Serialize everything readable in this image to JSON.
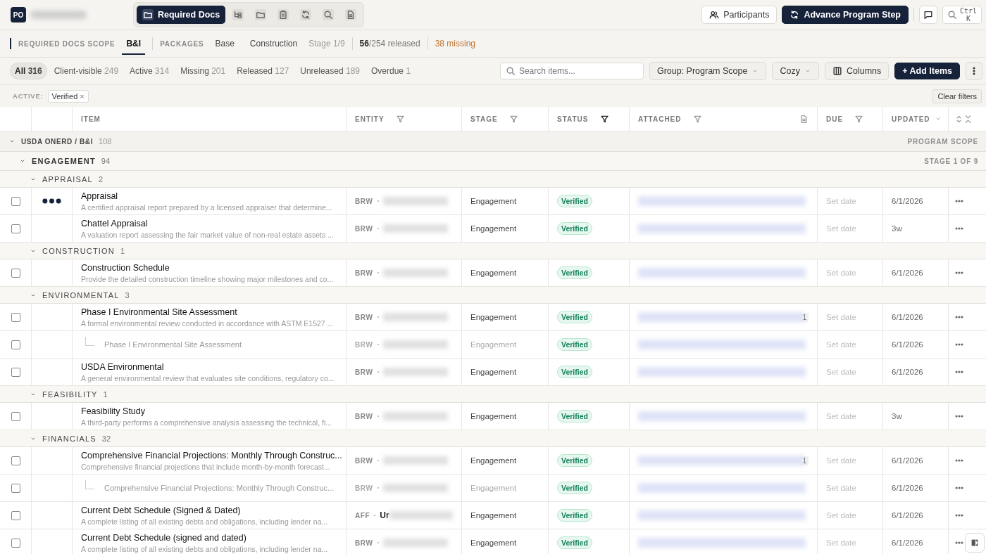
{
  "topbar": {
    "avatar": "PO",
    "nav": [
      {
        "kind": "label",
        "label": "Required Docs",
        "selected": true
      },
      {
        "kind": "icon",
        "selected": false
      },
      {
        "kind": "icon",
        "selected": false
      },
      {
        "kind": "icon",
        "selected": false
      },
      {
        "kind": "icon",
        "selected": false
      },
      {
        "kind": "icon",
        "selected": false
      },
      {
        "kind": "icon",
        "selected": false
      }
    ],
    "participants": "Participants",
    "advance": "Advance Program Step",
    "search_hint": "Ctrl K"
  },
  "scope": {
    "label": "REQUIRED DOCS SCOPE",
    "scope_tabs": [
      {
        "label": "B&I",
        "selected": true
      }
    ],
    "packages_label": "PACKAGES",
    "package_tabs": [
      {
        "label": "Base",
        "selected": false
      },
      {
        "label": "Construction",
        "selected": false
      }
    ],
    "stage": "Stage 1/9",
    "released": "**56**/254 released",
    "missing": "38 missing"
  },
  "filters": [
    {
      "label": "All",
      "count": "316",
      "selected": true
    },
    {
      "label": "Client-visible",
      "count": "249",
      "selected": false
    },
    {
      "label": "Active",
      "count": "314",
      "selected": false
    },
    {
      "label": "Missing",
      "count": "201",
      "selected": false
    },
    {
      "label": "Released",
      "count": "127",
      "selected": false
    },
    {
      "label": "Unreleased",
      "count": "189",
      "selected": false
    },
    {
      "label": "Overdue",
      "count": "1",
      "selected": false
    }
  ],
  "toolbar": {
    "search": {
      "placeholder": "Search items..."
    },
    "group": "Group: Program Scope",
    "density": "Cozy",
    "columns": "Columns",
    "add": "+ Add Items"
  },
  "active_filters": {
    "label": "ACTIVE:",
    "chips": [
      {
        "label": "Verified",
        "remove": "×"
      }
    ],
    "clear": "Clear filters"
  },
  "table": {
    "columns": [
      {
        "label": "ITEM",
        "kind": "plain"
      },
      {
        "label": "ENTITY",
        "kind": "filterable",
        "filter_active": false
      },
      {
        "label": "STAGE",
        "kind": "filterable",
        "filter_active": false
      },
      {
        "label": "STATUS",
        "kind": "filterable",
        "filter_active": true
      },
      {
        "label": "ATTACHED",
        "kind": "filterable",
        "filter_active": false
      },
      {
        "label": "DUE",
        "kind": "filterable",
        "filter_active": false
      },
      {
        "label": "UPDATED",
        "kind": "sortable"
      }
    ],
    "groups": [
      {
        "label": "USDA ONERD / B&I",
        "count": "108",
        "right": "PROGRAM SCOPE",
        "expanded": true,
        "children": [
          {
            "label": "ENGAGEMENT",
            "count": "94",
            "right": "STAGE 1 OF 9",
            "expanded": true,
            "children": [
              {
                "label": "APPRAISAL",
                "count": "2",
                "expanded": true,
                "items": [
                  {
                    "title": "Appraisal",
                    "description": "A certified appraisal report prepared by a licensed appraiser that determine...",
                    "dots": true,
                    "checked": false,
                    "entity": "BRW",
                    "stage": "Engagement",
                    "status": "Verified",
                    "due": "Set date",
                    "updated": "6/1/2026"
                  },
                  {
                    "title": "Chattel Appraisal",
                    "description": "A valuation report assessing the fair market value of non-real estate assets ...",
                    "dots": false,
                    "checked": false,
                    "entity": "BRW",
                    "stage": "Engagement",
                    "status": "Verified",
                    "due": "Set date",
                    "updated": "3w"
                  }
                ]
              },
              {
                "label": "CONSTRUCTION",
                "count": "1",
                "expanded": true,
                "items": [
                  {
                    "title": "Construction Schedule",
                    "description": "Provide the detailed construction timeline showing major milestones and co...",
                    "dots": false,
                    "checked": false,
                    "entity": "BRW",
                    "stage": "Engagement",
                    "status": "Verified",
                    "due": "Set date",
                    "updated": "6/1/2026"
                  }
                ]
              },
              {
                "label": "ENVIRONMENTAL",
                "count": "3",
                "expanded": true,
                "items": [
                  {
                    "title": "Phase I Environmental Site Assessment",
                    "description": "A formal environmental review conducted in accordance with ASTM E1527 ...",
                    "dots": false,
                    "checked": false,
                    "entity": "BRW",
                    "stage": "Engagement",
                    "status": "Verified",
                    "attach_count": "1",
                    "due": "Set date",
                    "updated": "6/1/2026",
                    "children": [
                      {
                        "title": "Phase I Environmental Site Assessment",
                        "checked": false,
                        "entity": "BRW",
                        "stage": "Engagement",
                        "status": "Verified",
                        "due": "Set date",
                        "updated": "6/1/2026"
                      }
                    ]
                  },
                  {
                    "title": "USDA Environmental",
                    "description": "A general environmental review that evaluates site conditions, regulatory co...",
                    "dots": false,
                    "checked": false,
                    "entity": "BRW",
                    "stage": "Engagement",
                    "status": "Verified",
                    "due": "Set date",
                    "updated": "6/1/2026"
                  }
                ]
              },
              {
                "label": "FEASIBILITY",
                "count": "1",
                "expanded": true,
                "items": [
                  {
                    "title": "Feasibility Study",
                    "description": "A third-party performs a comprehensive analysis assessing the technical, fi...",
                    "dots": false,
                    "checked": false,
                    "entity": "BRW",
                    "stage": "Engagement",
                    "status": "Verified",
                    "due": "Set date",
                    "updated": "3w"
                  }
                ]
              },
              {
                "label": "FINANCIALS",
                "count": "32",
                "expanded": true,
                "items": [
                  {
                    "title": "Comprehensive Financial Projections: Monthly Through Construc...",
                    "description": "Comprehensive financial projections that include month-by-month forecast...",
                    "dots": false,
                    "checked": false,
                    "entity": "BRW",
                    "stage": "Engagement",
                    "status": "Verified",
                    "attach_count": "1",
                    "due": "Set date",
                    "updated": "6/1/2026",
                    "children": [
                      {
                        "title": "Comprehensive Financial Projections: Monthly Through Construc...",
                        "checked": false,
                        "entity": "BRW",
                        "stage": "Engagement",
                        "status": "Verified",
                        "due": "Set date",
                        "updated": "6/1/2026"
                      }
                    ]
                  },
                  {
                    "title": "Current Debt Schedule (Signed & Dated)",
                    "description": "A complete listing of all existing debts and obligations, including lender na...",
                    "dots": false,
                    "checked": false,
                    "entity": "AFF",
                    "entity_name": "Ur",
                    "stage": "Engagement",
                    "status": "Verified",
                    "due": "Set date",
                    "updated": "6/1/2026"
                  },
                  {
                    "title": "Current Debt Schedule (signed and dated)",
                    "description": "A complete listing of all existing debts and obligations, including lender na...",
                    "dots": false,
                    "checked": false,
                    "entity": "BRW",
                    "stage": "Engagement",
                    "status": "Verified",
                    "due": "Set date",
                    "updated": "6/1/2026"
                  }
                ]
              }
            ]
          }
        ]
      }
    ]
  }
}
